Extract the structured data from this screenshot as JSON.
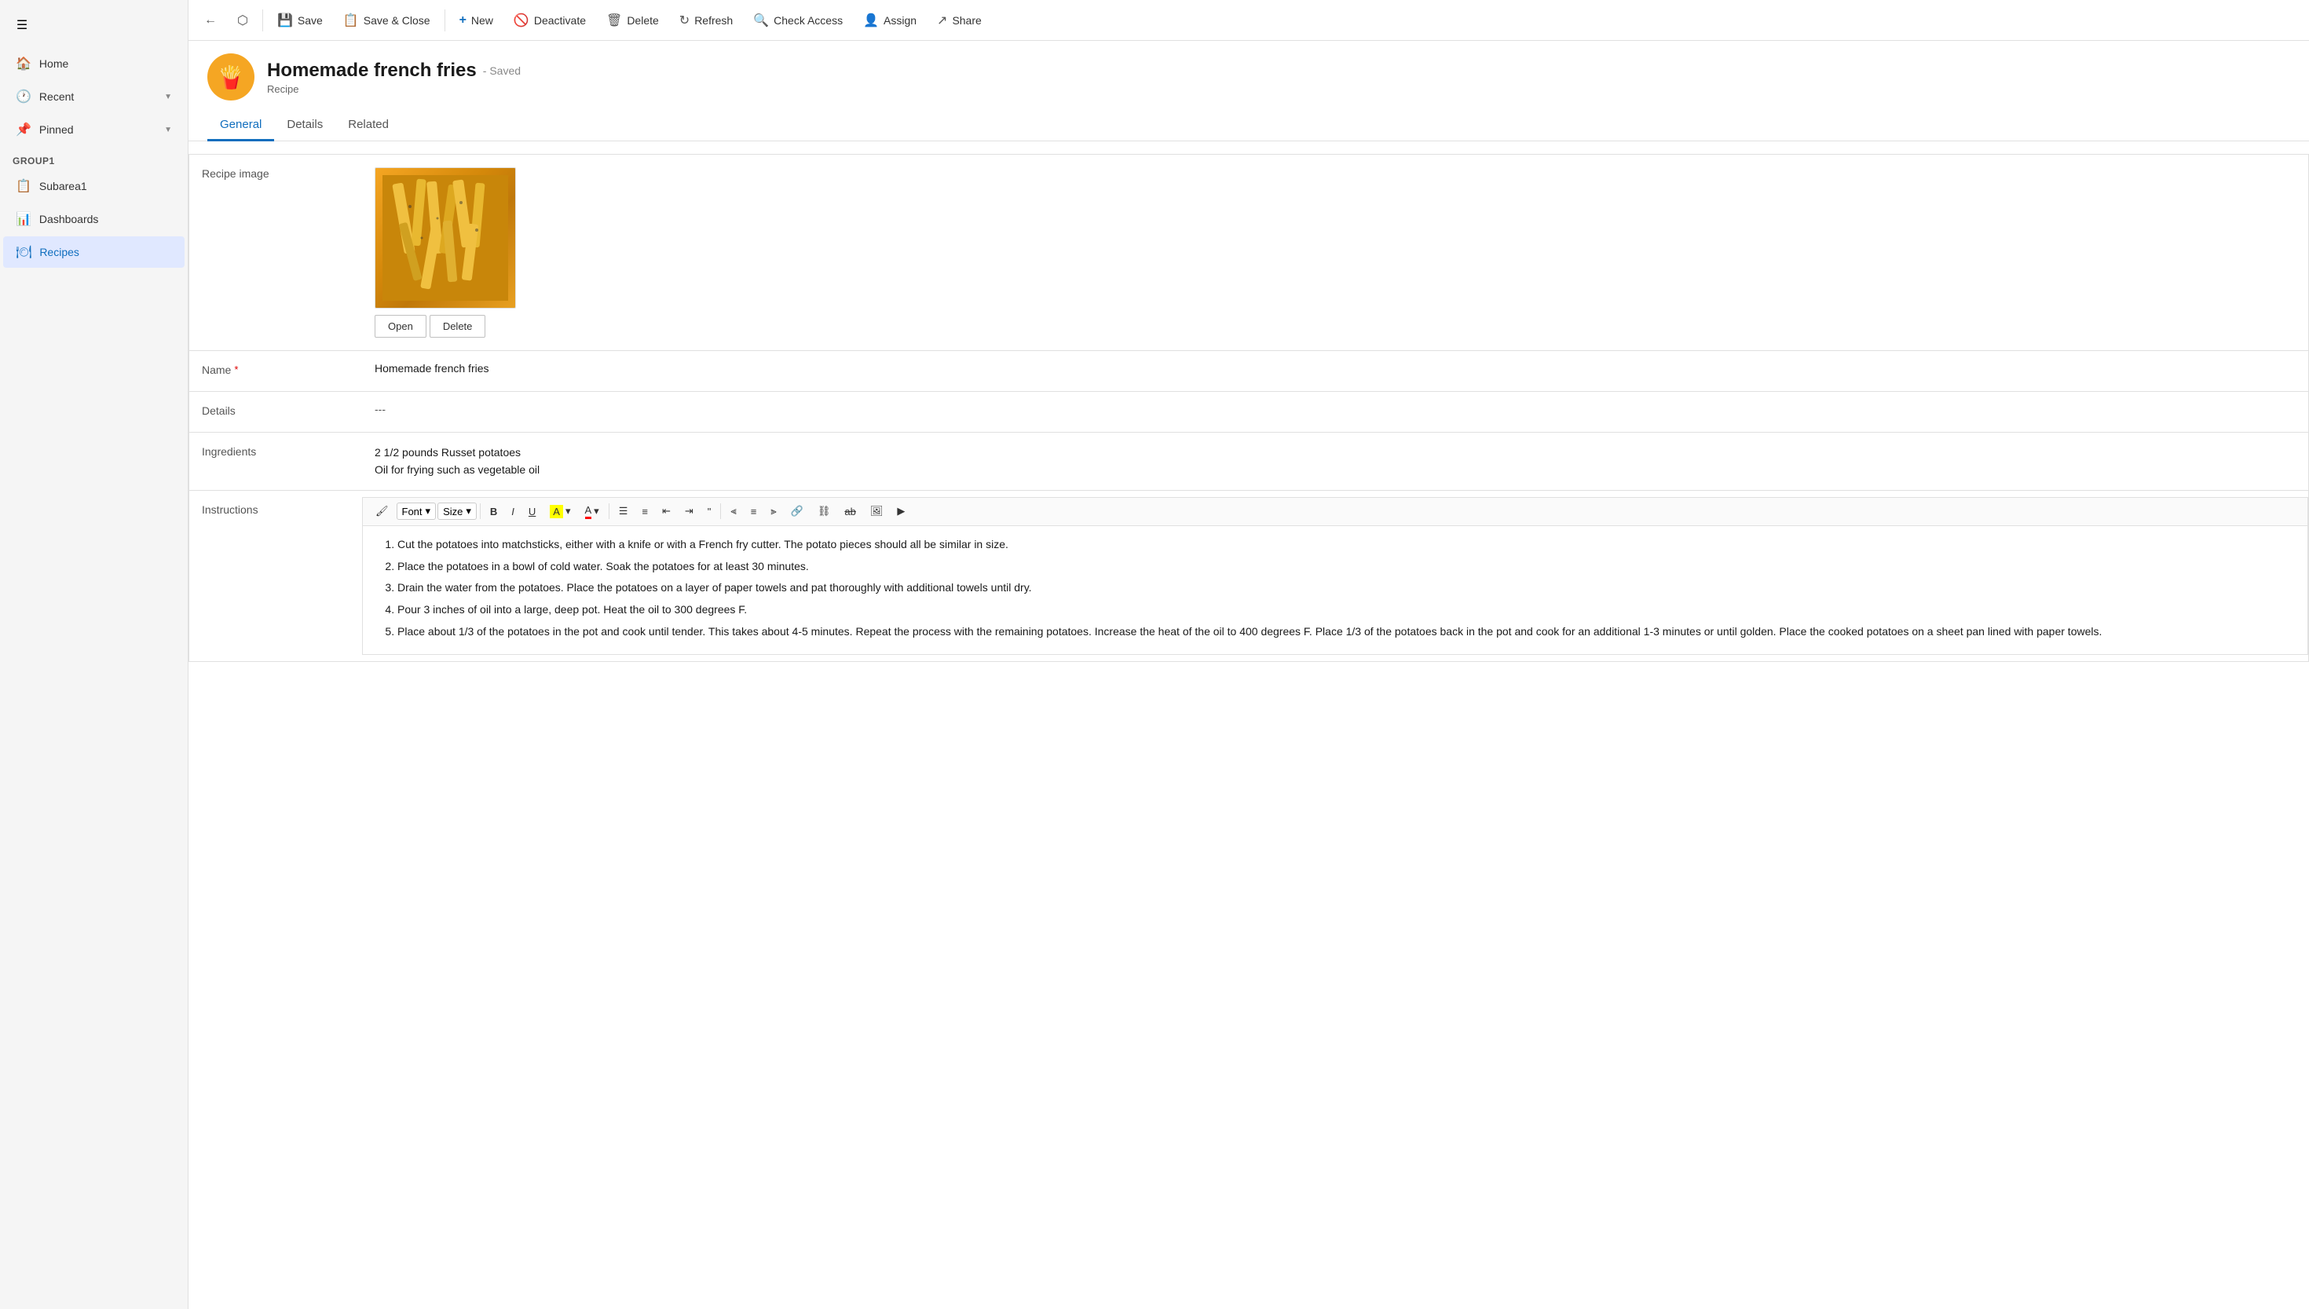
{
  "sidebar": {
    "menu_icon": "☰",
    "items": [
      {
        "id": "home",
        "label": "Home",
        "icon": "🏠",
        "active": false
      },
      {
        "id": "recent",
        "label": "Recent",
        "icon": "🕐",
        "active": false,
        "expandable": true
      },
      {
        "id": "pinned",
        "label": "Pinned",
        "icon": "📌",
        "active": false,
        "expandable": true
      }
    ],
    "group1_label": "Group1",
    "group1_items": [
      {
        "id": "subarea1",
        "label": "Subarea1",
        "icon": "📋",
        "active": false
      },
      {
        "id": "dashboards",
        "label": "Dashboards",
        "icon": "📊",
        "active": false
      },
      {
        "id": "recipes",
        "label": "Recipes",
        "icon": "🍽",
        "active": true
      }
    ]
  },
  "toolbar": {
    "back_label": "←",
    "open_label": "⬡",
    "save_label": "Save",
    "save_close_label": "Save & Close",
    "new_label": "New",
    "deactivate_label": "Deactivate",
    "delete_label": "Delete",
    "refresh_label": "Refresh",
    "check_access_label": "Check Access",
    "assign_label": "Assign",
    "share_label": "Share"
  },
  "record": {
    "title": "Homemade french fries",
    "saved_badge": "- Saved",
    "subtitle": "Recipe",
    "avatar_emoji": "🍟"
  },
  "tabs": [
    {
      "id": "general",
      "label": "General",
      "active": true
    },
    {
      "id": "details",
      "label": "Details",
      "active": false
    },
    {
      "id": "related",
      "label": "Related",
      "active": false
    }
  ],
  "form": {
    "recipe_image_label": "Recipe image",
    "image_open_btn": "Open",
    "image_delete_btn": "Delete",
    "name_label": "Name",
    "name_required": "*",
    "name_value": "Homemade french fries",
    "details_label": "Details",
    "details_value": "---",
    "ingredients_label": "Ingredients",
    "ingredients_line1": "2 1/2 pounds Russet potatoes",
    "ingredients_line2": "Oil for frying such as vegetable oil",
    "instructions_label": "Instructions",
    "instructions_toolbar": {
      "font_label": "Font",
      "size_label": "Size",
      "bold_label": "B",
      "italic_label": "I",
      "underline_label": "U",
      "highlight_label": "A",
      "font_color_label": "A"
    },
    "instructions_items": [
      "Cut the potatoes into matchsticks, either with a knife or with a French fry cutter. The potato pieces should all be similar in size.",
      "Place the potatoes in a bowl of cold water. Soak the potatoes for at least 30 minutes.",
      "Drain the water from the potatoes. Place the potatoes on a layer of paper towels and pat thoroughly with additional towels until dry.",
      "Pour 3 inches of oil into a large, deep pot. Heat the oil to 300 degrees F.",
      "Place about 1/3 of the potatoes in the pot and cook until tender. This takes about 4-5 minutes. Repeat the process with the remaining potatoes. Increase the heat of the oil to 400 degrees F. Place 1/3 of the potatoes back in the pot and cook for an additional 1-3 minutes or until golden. Place the cooked potatoes on a sheet pan lined with paper towels."
    ]
  }
}
